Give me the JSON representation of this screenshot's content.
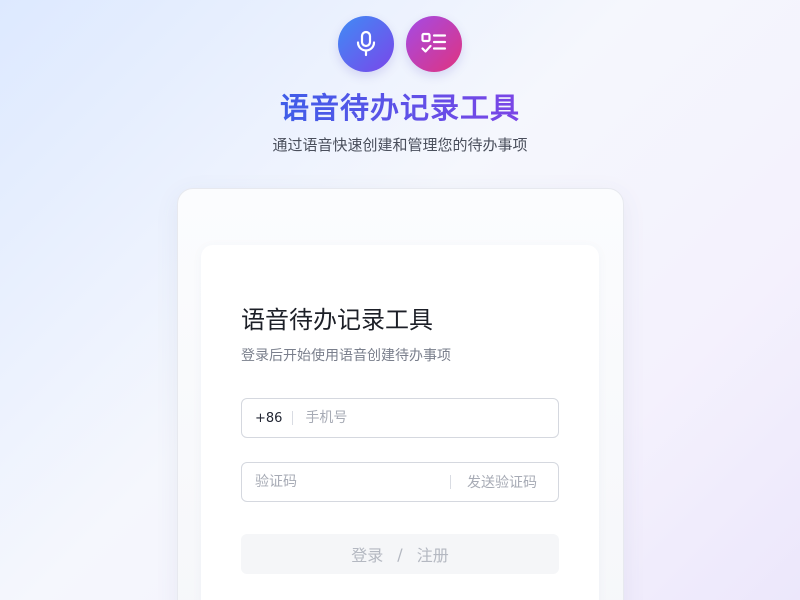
{
  "hero": {
    "icons": [
      "microphone-icon",
      "checklist-icon"
    ],
    "title": "语音待办记录工具",
    "subtitle": "通过语音快速创建和管理您的待办事项"
  },
  "form": {
    "title": "语音待办记录工具",
    "subtitle": "登录后开始使用语音创建待办事项",
    "phone": {
      "prefix": "+86",
      "placeholder": "手机号",
      "value": ""
    },
    "code": {
      "placeholder": "验证码",
      "value": "",
      "send_label": "发送验证码"
    },
    "submit": {
      "login_label": "登录",
      "separator": "/",
      "register_label": "注册"
    }
  },
  "colors": {
    "brand_blue": "#3f5ee8",
    "brand_purple": "#7b45e6",
    "mic_gradient": [
      "#3f8cf5",
      "#7a46ea"
    ],
    "list_gradient": [
      "#a34be6",
      "#e0337f"
    ],
    "disabled_text": "#b4b8c1"
  }
}
